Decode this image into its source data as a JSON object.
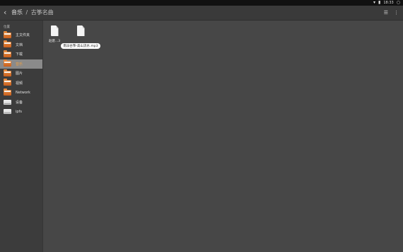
{
  "status_bar": {
    "time": "18:33",
    "icons": [
      "wifi-icon",
      "battery-icon",
      "settings-icon"
    ]
  },
  "toolbar": {
    "back_icon": "‹",
    "breadcrumb_parent": "音乐",
    "breadcrumb_sep": "/",
    "breadcrumb_current": "古筝名曲",
    "view_icon": "☰",
    "more_icon": "⋮"
  },
  "sidebar": {
    "section_label": "位置",
    "items": [
      {
        "label": "主文件夹",
        "icon": "folder-home-icon"
      },
      {
        "label": "文档",
        "icon": "folder-documents-icon"
      },
      {
        "label": "下载",
        "icon": "folder-download-icon"
      },
      {
        "label": "音乐",
        "icon": "folder-music-icon",
        "active": true
      },
      {
        "label": "图片",
        "icon": "folder-pictures-icon"
      },
      {
        "label": "视频",
        "icon": "folder-videos-icon"
      },
      {
        "label": "Network",
        "icon": "folder-network-icon"
      },
      {
        "label": "设备",
        "icon": "drive-icon"
      },
      {
        "label": "ipfs",
        "icon": "drive-icon"
      }
    ]
  },
  "files": [
    {
      "name": "赵建…3",
      "icon": "audio-file-icon",
      "selected": false
    },
    {
      "name": "南派古筝-高山流水.mp3",
      "icon": "audio-file-icon",
      "selected": true
    }
  ],
  "colors": {
    "accent": "#e58a3e",
    "active_text": "#f0a040",
    "background": "#474747"
  }
}
